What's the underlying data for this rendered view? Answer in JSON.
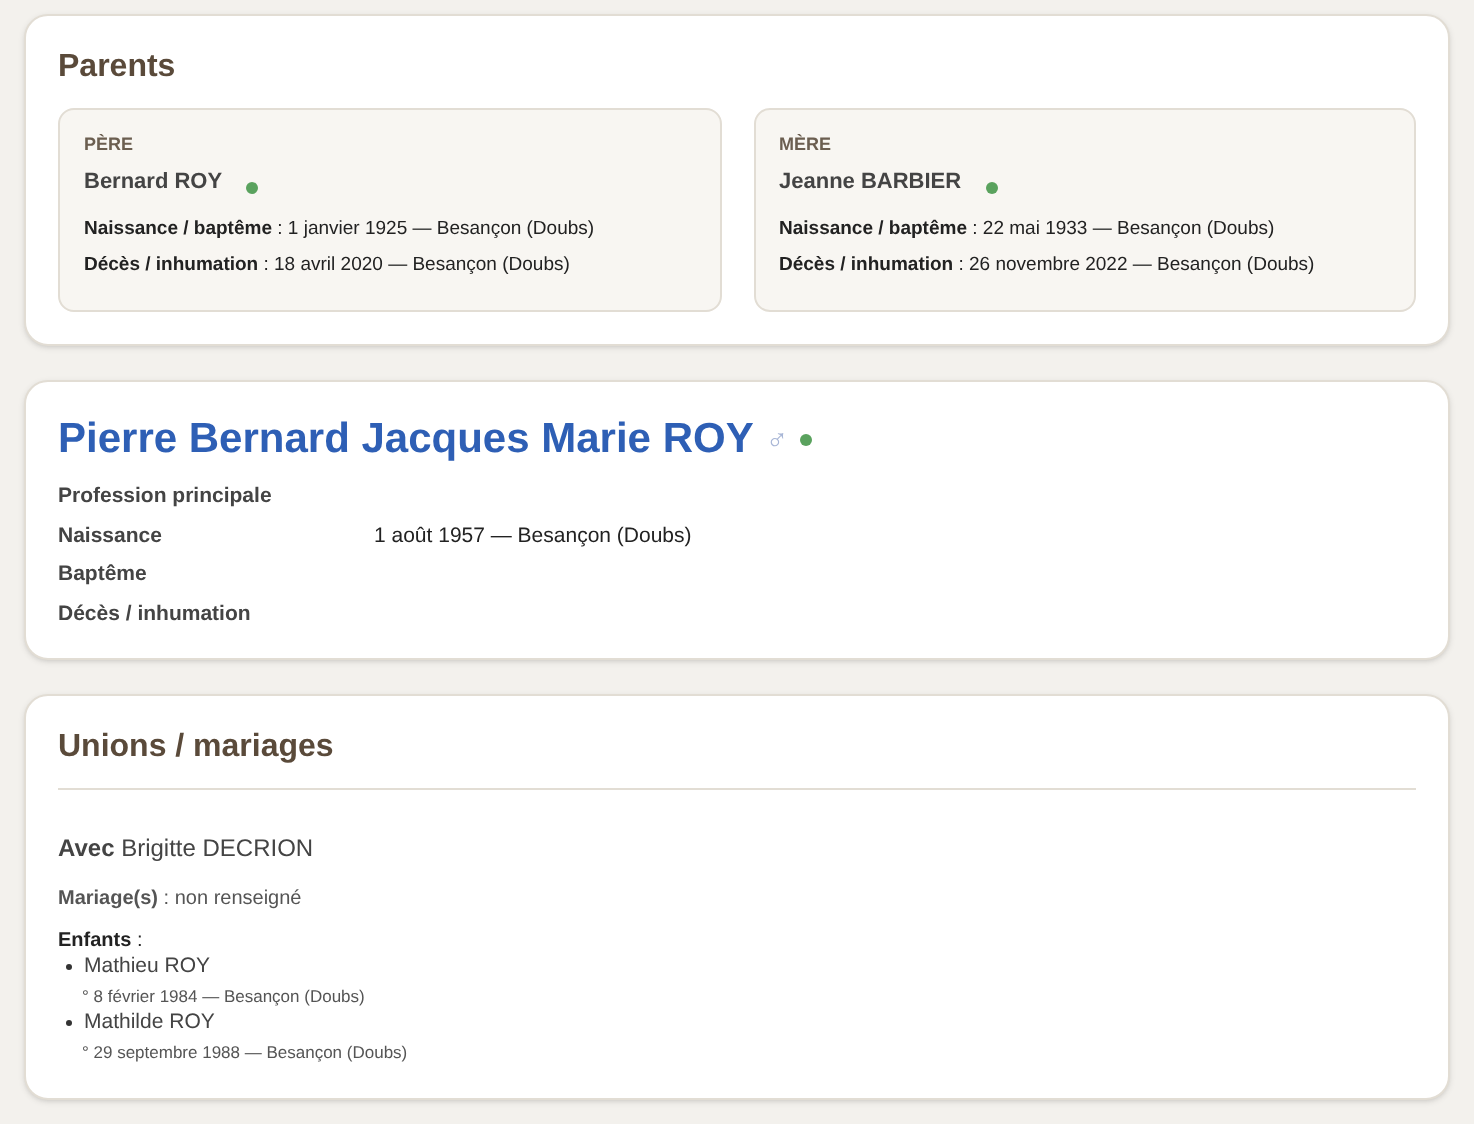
{
  "parents": {
    "title": "Parents",
    "cards": [
      {
        "role": "PÈRE",
        "name": "Bernard ROY",
        "color": "#5aa25e",
        "lines": [
          "**Naissance / baptême** : 1 janvier 1925 — Besançon (Doubs)",
          "**Décès / inhumation** : 18 avril 2020 — Besançon (Doubs)"
        ]
      },
      {
        "role": "MÈRE",
        "name": "Jeanne BARBIER",
        "color": "#5aa25e",
        "lines": [
          "**Naissance / baptême** : 22 mai 1933 — Besançon (Doubs)",
          "**Décès / inhumation** : 26 novembre 2022 — Besançon (Doubs)"
        ]
      }
    ]
  },
  "person": {
    "name": "Pierre Bernard Jacques Marie ROY",
    "sex_symbol": "♂",
    "color": "#5aa25e",
    "facts": [
      {
        "label": "Profession principale"
      },
      {
        "label": "Naissance",
        "value": "1 août 1957 — Besançon (Doubs)"
      },
      {
        "label": "Baptême"
      },
      {
        "label": "Décès / inhumation"
      }
    ]
  },
  "unions": {
    "title": "Unions / mariages",
    "items": [
      {
        "spouse": "**Avec** Brigitte DECRION",
        "marriage": "**Mariage(s)** : non renseigné",
        "children_label": "**Enfants** :",
        "children": [
          {
            "name": "Mathieu ROY",
            "birth": "° 8 février 1984 — Besançon (Doubs)"
          },
          {
            "name": "Mathilde ROY",
            "birth": "° 29 septembre 1988 — Besançon (Doubs)"
          }
        ]
      }
    ]
  }
}
